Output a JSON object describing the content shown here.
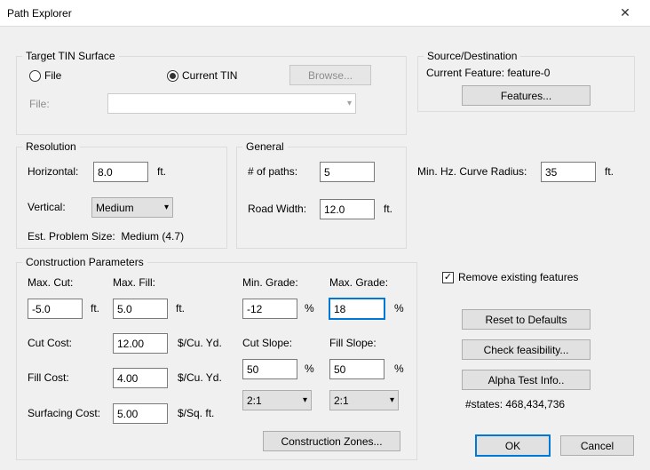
{
  "window": {
    "title": "Path Explorer"
  },
  "target": {
    "legend": "Target TIN Surface",
    "file_radio": "File",
    "current_radio": "Current TIN",
    "current_checked": true,
    "browse": "Browse...",
    "file_label": "File:"
  },
  "srcdest": {
    "legend": "Source/Destination",
    "current_feature_label": "Current Feature:",
    "current_feature_value": "feature-0",
    "features_btn": "Features..."
  },
  "resolution": {
    "legend": "Resolution",
    "horizontal_label": "Horizontal:",
    "horizontal_value": "8.0",
    "horizontal_unit": "ft.",
    "vertical_label": "Vertical:",
    "vertical_value": "Medium",
    "est_label": "Est. Problem Size:",
    "est_value": "Medium (4.7)"
  },
  "general": {
    "legend": "General",
    "paths_label": "# of paths:",
    "paths_value": "5",
    "road_label": "Road Width:",
    "road_value": "12.0",
    "road_unit": "ft.",
    "radius_label": "Min. Hz. Curve Radius:",
    "radius_value": "35",
    "radius_unit": "ft."
  },
  "construction": {
    "legend": "Construction Parameters",
    "max_cut_label": "Max. Cut:",
    "max_cut_value": "-5.0",
    "max_cut_unit": "ft.",
    "max_fill_label": "Max. Fill:",
    "max_fill_value": "5.0",
    "max_fill_unit": "ft.",
    "cut_cost_label": "Cut Cost:",
    "cut_cost_value": "12.00",
    "cut_cost_unit": "$/Cu. Yd.",
    "fill_cost_label": "Fill Cost:",
    "fill_cost_value": "4.00",
    "fill_cost_unit": "$/Cu. Yd.",
    "surf_cost_label": "Surfacing Cost:",
    "surf_cost_value": "5.00",
    "surf_cost_unit": "$/Sq. ft.",
    "min_grade_label": "Min. Grade:",
    "min_grade_value": "-12",
    "max_grade_label": "Max. Grade:",
    "max_grade_value": "18",
    "pct": "%",
    "cut_slope_label": "Cut Slope:",
    "cut_slope_value": "50",
    "fill_slope_label": "Fill Slope:",
    "fill_slope_value": "50",
    "ratio_a": "2:1",
    "ratio_b": "2:1",
    "zones_btn": "Construction Zones..."
  },
  "right": {
    "remove_check": "Remove existing features",
    "remove_checked": true,
    "reset": "Reset to Defaults",
    "feas": "Check feasibility...",
    "alpha": "Alpha Test Info..",
    "states_label": "#states:",
    "states_value": "468,434,736"
  },
  "buttons": {
    "ok": "OK",
    "cancel": "Cancel"
  }
}
